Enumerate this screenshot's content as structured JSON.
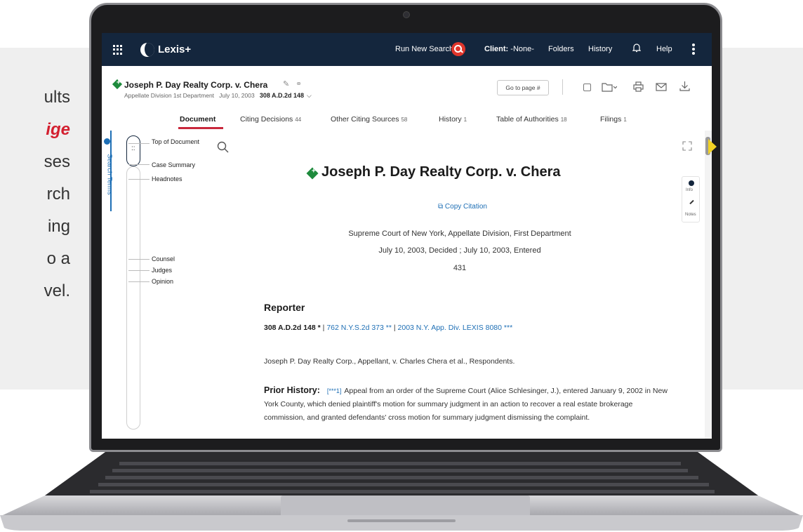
{
  "slide_text": {
    "lines": [
      "ults",
      "ige",
      "ses",
      "rch",
      "ing",
      "o a",
      "vel."
    ]
  },
  "app": {
    "name": "Lexis+",
    "run_new_search": "Run New Search",
    "client_label": "Client:",
    "client_value": "-None-",
    "folders": "Folders",
    "history": "History",
    "help": "Help"
  },
  "doc": {
    "title": "Joseph P. Day Realty Corp. v. Chera",
    "court_short": "Appellate Division 1st Department",
    "date": "July 10, 2003",
    "citation": "308 A.D.2d 148",
    "goto": "Go to page #"
  },
  "tabs": [
    {
      "label": "Document",
      "count": ""
    },
    {
      "label": "Citing Decisions",
      "count": "44"
    },
    {
      "label": "Other Citing Sources",
      "count": "58"
    },
    {
      "label": "History",
      "count": "1"
    },
    {
      "label": "Table of Authorities",
      "count": "18"
    },
    {
      "label": "Filings",
      "count": "1"
    }
  ],
  "search_terms": "Search Terms",
  "outline": [
    "Top of Document",
    "Case Summary",
    "Headnotes",
    "Counsel",
    "Judges",
    "Opinion"
  ],
  "body": {
    "title": "Joseph P. Day Realty Corp. v. Chera",
    "copy_citation": "Copy Citation",
    "court": "Supreme Court of New York, Appellate Division, First Department",
    "dates": "July 10, 2003, Decided ; July 10, 2003, Entered",
    "number": "431",
    "reporter_heading": "Reporter",
    "reporter_main": "308 A.D.2d 148 *",
    "reporter_link1": "762 N.Y.S.2d 373 **",
    "reporter_link2": "2003 N.Y. App. Div. LEXIS 8080 ***",
    "parties": "Joseph P. Day Realty Corp., Appellant, v. Charles Chera et al., Respondents.",
    "prior_heading": "Prior History:",
    "prior_marker": "[***1]",
    "prior_text": "Appeal from an order of the Supreme Court (Alice Schlesinger, J.), entered January 9, 2002 in New York County, which denied plaintiff's motion for summary judgment in an action to recover a real estate brokerage commission, and granted defendants' cross motion for summary judgment dismissing the complaint."
  },
  "side_tools": {
    "info": "Info",
    "notes": "Notes"
  },
  "colors": {
    "nav": "#14263d",
    "accent_red": "#c9283c",
    "link": "#1e6fb5",
    "green": "#1d8a3c"
  }
}
